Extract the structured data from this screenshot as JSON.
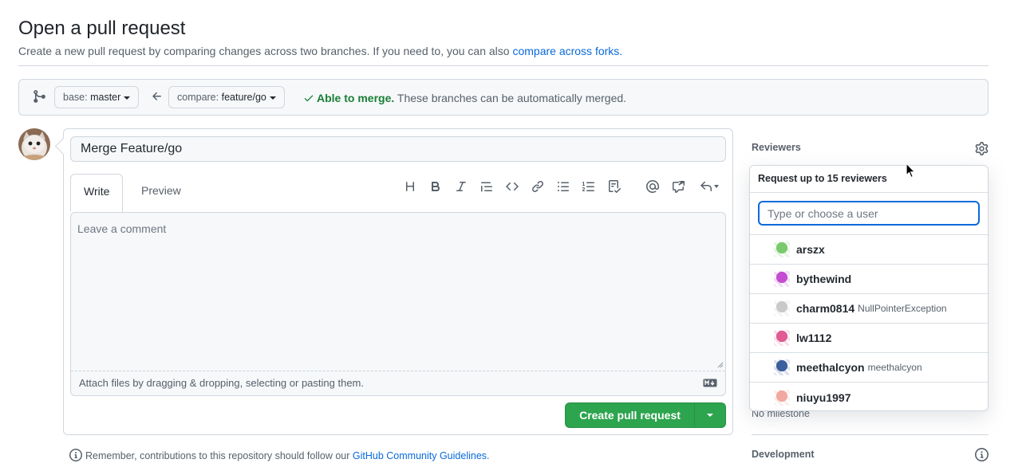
{
  "page": {
    "title": "Open a pull request",
    "subtitle": "Create a new pull request by comparing changes across two branches. If you need to, you can also",
    "subtitle_link": "compare across forks.",
    "remember_text": "Remember, contributions to this repository should follow our",
    "remember_link": "GitHub Community Guidelines."
  },
  "compare": {
    "base_prefix": "base:",
    "base_branch": "master",
    "compare_prefix": "compare:",
    "compare_branch": "feature/go",
    "merge_ok": "Able to merge.",
    "merge_msg": "These branches can be automatically merged."
  },
  "composer": {
    "title_value": "Merge Feature/go",
    "tabs": [
      {
        "label": "Write",
        "active": true
      },
      {
        "label": "Preview",
        "active": false
      }
    ],
    "toolbar_icons": [
      "heading-icon",
      "bold-icon",
      "italic-icon",
      "quote-icon",
      "code-icon",
      "link-icon",
      "unordered-list-icon",
      "ordered-list-icon",
      "task-list-icon",
      "mention-icon",
      "cross-reference-icon",
      "saved-reply-icon"
    ],
    "comment_placeholder": "Leave a comment",
    "attach_hint": "Attach files by dragging & dropping, selecting or pasting them.",
    "submit_label": "Create pull request"
  },
  "sidebar": {
    "reviewers_heading": "Reviewers",
    "no_milestone": "No milestone",
    "development_heading": "Development"
  },
  "reviewer_popover": {
    "header": "Request up to 15 reviewers",
    "search_placeholder": "Type or choose a user",
    "users": [
      {
        "login": "arszx",
        "name": "",
        "color": "#7bc96f"
      },
      {
        "login": "bythewind",
        "name": "",
        "color": "#c44dd1"
      },
      {
        "login": "charm0814",
        "name": "NullPointerException",
        "color": "#c9c9c9"
      },
      {
        "login": "lw1112",
        "name": "",
        "color": "#e05a93"
      },
      {
        "login": "meethalcyon",
        "name": "meethalcyon",
        "color": "#3b5f9e"
      },
      {
        "login": "niuyu1997",
        "name": "",
        "color": "#f0a8a0"
      }
    ]
  },
  "colors": {
    "accent_blue": "#0969da",
    "success_green": "#2da44e",
    "merge_green": "#1a7f37",
    "border": "#d0d7de"
  }
}
